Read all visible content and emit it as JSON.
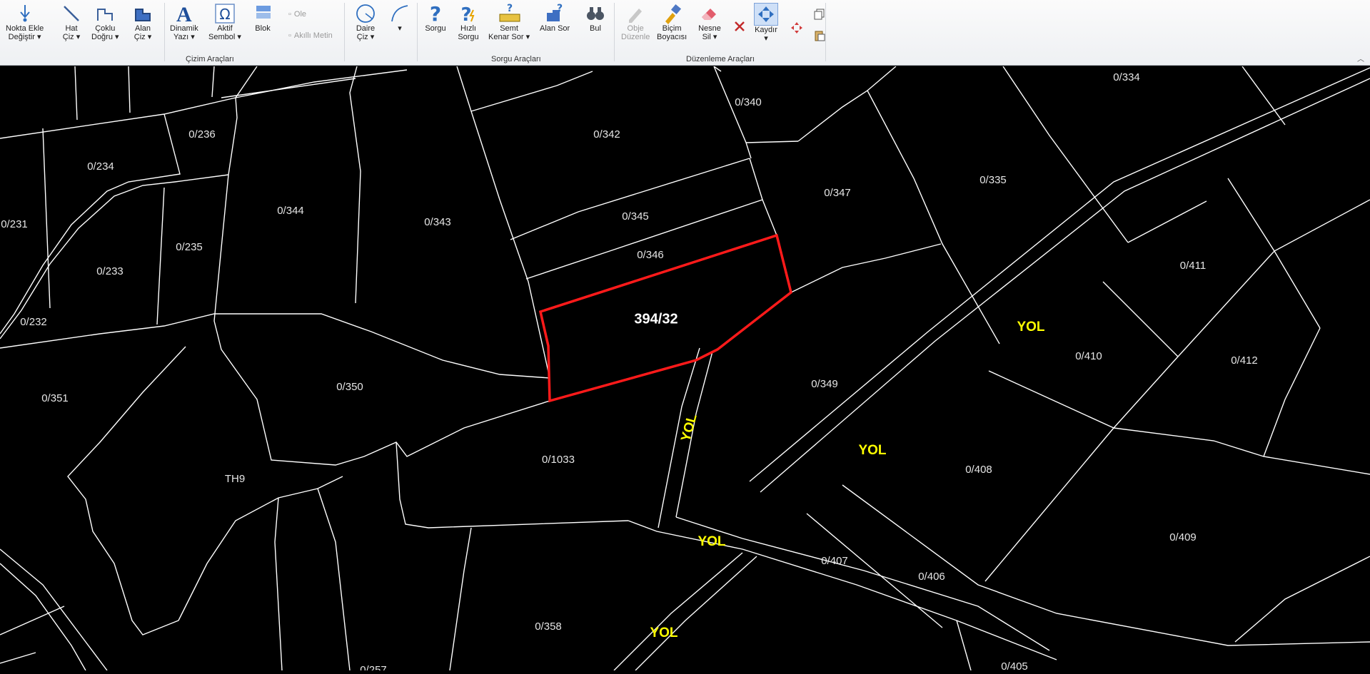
{
  "ribbon": {
    "tools": [
      {
        "label": "Nokta Ekle\nDeğiştir ▾",
        "icon": "point-edit-icon"
      },
      {
        "label": "Hat\nÇiz ▾",
        "icon": "line-draw-icon"
      },
      {
        "label": "Çoklu\nDoğru ▾",
        "icon": "polyline-icon"
      },
      {
        "label": "Alan\nÇiz ▾",
        "icon": "area-draw-icon"
      },
      {
        "label": "Dinamik\nYazı ▾",
        "icon": "dynamic-text-icon"
      },
      {
        "label": "Aktif\nSembol ▾",
        "icon": "symbol-icon"
      },
      {
        "label": "Blok",
        "icon": "block-icon"
      },
      {
        "label": "Daire\nÇiz ▾",
        "icon": "circle-draw-icon"
      },
      {
        "label": "▾",
        "icon": "arc-draw-icon"
      },
      {
        "label": "Sorgu",
        "icon": "query-icon"
      },
      {
        "label": "Hızlı\nSorgu",
        "icon": "quick-query-icon"
      },
      {
        "label": "Semt\nKenar Sor ▾",
        "icon": "edge-measure-icon"
      },
      {
        "label": "Alan Sor",
        "icon": "area-query-icon"
      },
      {
        "label": "Bul",
        "icon": "binoculars-icon"
      },
      {
        "label": "Obje\nDüzenle",
        "icon": "object-edit-icon"
      },
      {
        "label": "Biçim\nBoyacısı",
        "icon": "format-painter-icon"
      },
      {
        "label": "Nesne\nSil ▾",
        "icon": "eraser-icon"
      },
      {
        "label": "Kaydır\n▾",
        "icon": "move-icon"
      }
    ],
    "small_tools": {
      "ole": "Ole",
      "smart_text": "Akıllı Metin"
    },
    "groups": {
      "drawing": "Çizim Araçları",
      "query": "Sorgu Araçları",
      "edit": "Düzenleme Araçları"
    }
  },
  "map": {
    "selected_parcel": "394/32",
    "parcels": [
      "0/334",
      "0/340",
      "0/342",
      "0/236",
      "0/234",
      "0/347",
      "0/335",
      "0/231",
      "0/344",
      "0/343",
      "0/345",
      "0/235",
      "0/346",
      "0/233",
      "0/411",
      "0/232",
      "0/410",
      "0/412",
      "0/351",
      "0/350",
      "0/349",
      "0/1033",
      "TH9",
      "0/408",
      "0/407",
      "0/406",
      "0/409",
      "0/358",
      "0/257",
      "0/405"
    ],
    "roads": [
      "YOL",
      "YOL",
      "YOL",
      "YOL",
      "YOL"
    ],
    "colors": {
      "background": "#000000",
      "parcel_line": "#ffffff",
      "selection": "#ff1a1a",
      "road_label": "#ffff00"
    }
  }
}
